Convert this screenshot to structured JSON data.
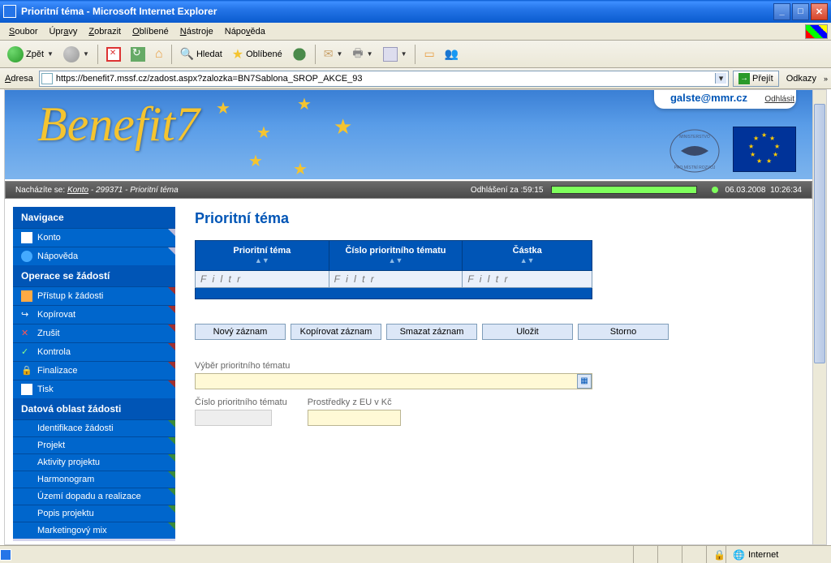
{
  "window": {
    "title": "Prioritní téma - Microsoft Internet Explorer"
  },
  "menubar": {
    "soubor": "Soubor",
    "upravy": "Úpravy",
    "zobrazit": "Zobrazit",
    "oblibene": "Oblíbené",
    "nastroje": "Nástroje",
    "napoveda": "Nápověda"
  },
  "toolbar": {
    "back": "Zpět",
    "search": "Hledat",
    "favorites": "Oblíbené"
  },
  "addressbar": {
    "label": "Adresa",
    "url": "https://benefit7.mssf.cz/zadost.aspx?zalozka=BN7Sablona_SROP_AKCE_93",
    "go": "Přejít",
    "links": "Odkazy"
  },
  "banner": {
    "logo": "Benefit7",
    "email": "galste@mmr.cz",
    "logout": "Odhlásit"
  },
  "breadcrumb": {
    "prefix": "Nacházíte se:",
    "konto": "Konto",
    "id": "299371",
    "page": "Prioritní téma",
    "countdown_label": "Odhlášení za :",
    "countdown_time": "59:15",
    "date": "06.03.2008",
    "time": "10:26:34"
  },
  "sidebar": {
    "nav_header": "Navigace",
    "konto": "Konto",
    "napoveda": "Nápověda",
    "ops_header": "Operace se žádostí",
    "pristup": "Přístup k žádosti",
    "kopirovat": "Kopírovat",
    "zrusit": "Zrušit",
    "kontrola": "Kontrola",
    "finalizace": "Finalizace",
    "tisk": "Tisk",
    "data_header": "Datová oblast žádosti",
    "identifikace": "Identifikace žádosti",
    "projekt": "Projekt",
    "aktivity": "Aktivity projektu",
    "harmonogram": "Harmonogram",
    "uzemi": "Území dopadu a realizace",
    "popis": "Popis projektu",
    "marketing": "Marketingový mix"
  },
  "main": {
    "heading": "Prioritní téma",
    "table": {
      "col1": "Prioritní téma",
      "col2": "Číslo prioritního tématu",
      "col3": "Částka",
      "filter_placeholder": "F i l t r"
    },
    "buttons": {
      "novy": "Nový záznam",
      "kopirovat": "Kopírovat záznam",
      "smazat": "Smazat záznam",
      "ulozit": "Uložit",
      "storno": "Storno"
    },
    "form": {
      "vyber_label": "Výběr prioritního tématu",
      "cislo_label": "Číslo prioritního tématu",
      "prostredky_label": "Prostředky z EU v Kč"
    }
  },
  "statusbar": {
    "zone": "Internet"
  }
}
